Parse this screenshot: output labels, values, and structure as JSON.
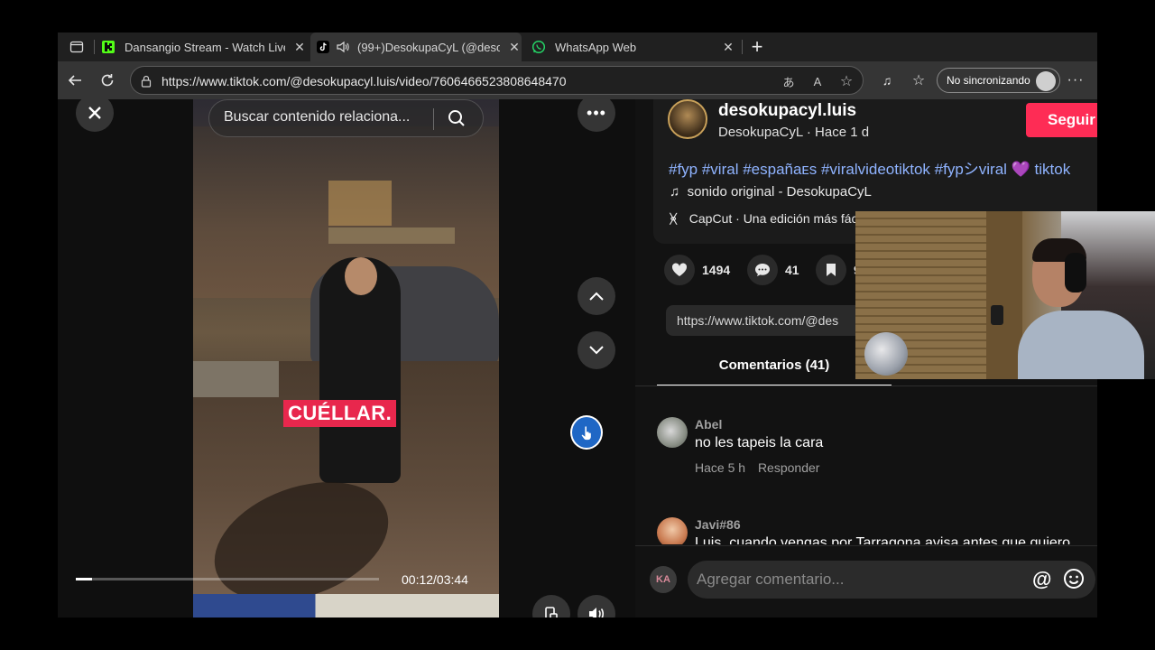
{
  "browser": {
    "tabs": [
      {
        "title": "Dansangio Stream - Watch Live",
        "icon": "kick-icon",
        "active": false
      },
      {
        "title": "(99+)DesokupaCyL (@deso",
        "icon": "tiktok-icon",
        "active": true
      },
      {
        "title": "WhatsApp Web",
        "icon": "whatsapp-icon",
        "active": false
      }
    ],
    "url": "https://www.tiktok.com/@desokupacyl.luis/video/7606466523808648470",
    "sync_label": "No sincronizando"
  },
  "video": {
    "search_placeholder": "Buscar contenido relaciona...",
    "caption_text": "CUÉLLAR.",
    "time_display": "00:12/03:44",
    "progress_fraction": 0.054
  },
  "post": {
    "username": "desokupacyl.luis",
    "display_name": "DesokupaCyL",
    "time_ago": "Hace 1 d",
    "follow_label": "Seguir",
    "hashtags": "#fyp #viral #españaᴇs #viralvideotiktok #fypシviral 💜 tiktok",
    "sound": "sonido original - DesokupaCyL",
    "capcut": "CapCut · Una edición más fác",
    "likes": "1494",
    "comments": "41",
    "saves": "9",
    "share_link": "https://www.tiktok.com/@des"
  },
  "comments_tab": {
    "label": "Comentarios (41)",
    "items": [
      {
        "user": "Abel",
        "text": "no les tapeis la cara",
        "time": "Hace 5 h",
        "reply": "Responder"
      },
      {
        "user": "Javi#86",
        "text": "Luis, cuando vengas por Tarragona avisa antes que quiero",
        "time": "",
        "reply": ""
      }
    ],
    "input_placeholder": "Agregar comentario...",
    "my_avatar_initials": "KA"
  },
  "colors": {
    "follow_button": "#fe2c55",
    "hashtag": "#8fb3ff",
    "caption_bg": "#e8274d"
  }
}
